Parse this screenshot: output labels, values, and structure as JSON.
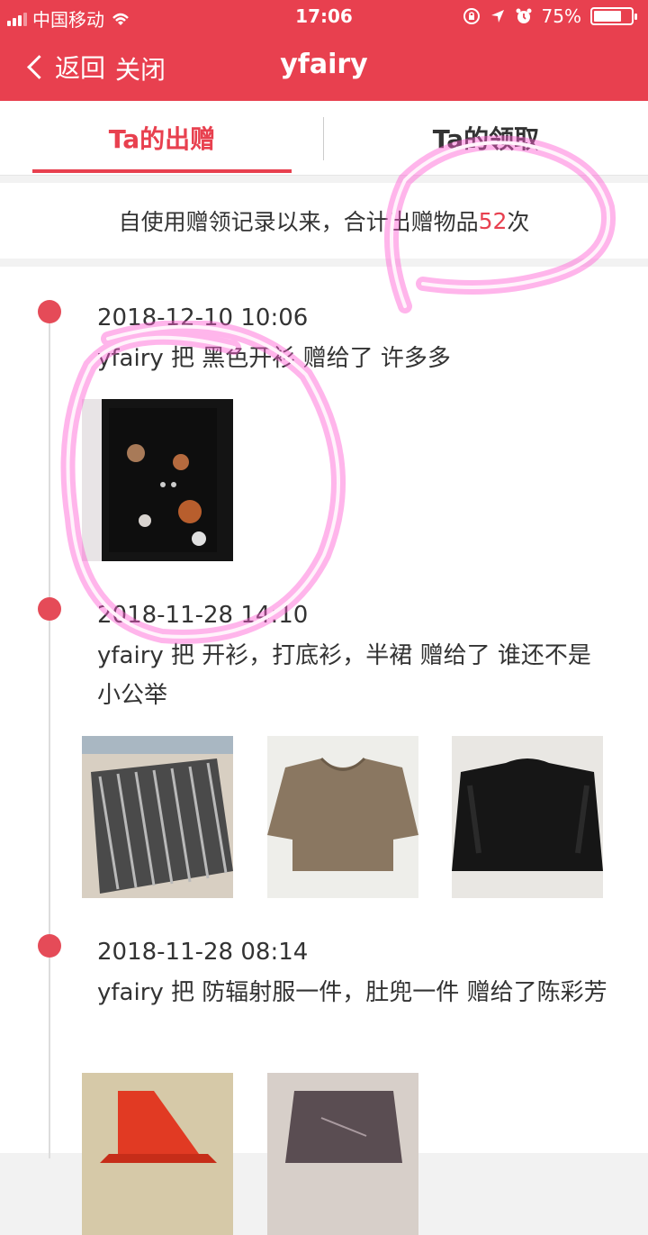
{
  "status_bar": {
    "carrier": "中国移动",
    "time": "17:06",
    "battery": "75%",
    "battery_level": 0.75,
    "icons": [
      "signal-icon",
      "wifi-icon",
      "lock-rotation-icon",
      "location-icon",
      "alarm-icon",
      "battery-icon"
    ]
  },
  "nav": {
    "back_label": "返回",
    "close_label": "关闭",
    "title": "yfairy"
  },
  "tabs": [
    {
      "label": "Ta的出赠",
      "active": true
    },
    {
      "label": "Ta的领取",
      "active": false
    }
  ],
  "summary": {
    "prefix": "自使用赠领记录以来，合计出赠物品",
    "count": "52",
    "suffix": "次"
  },
  "entries": [
    {
      "date": "2018-12-10 10:06",
      "desc": "yfairy 把 黑色开衫 赠给了 许多多"
    },
    {
      "date": "2018-11-28 14:10",
      "desc": "yfairy 把 开衫，打底衫，半裙 赠给了 谁还不是小公举"
    },
    {
      "date": "2018-11-28 08:14",
      "desc": "yfairy 把 防辐射服一件，肚兜一件 赠给了陈彩芳"
    }
  ],
  "colors": {
    "brand": "#e8404f",
    "highlight": "#ff5ad2"
  }
}
